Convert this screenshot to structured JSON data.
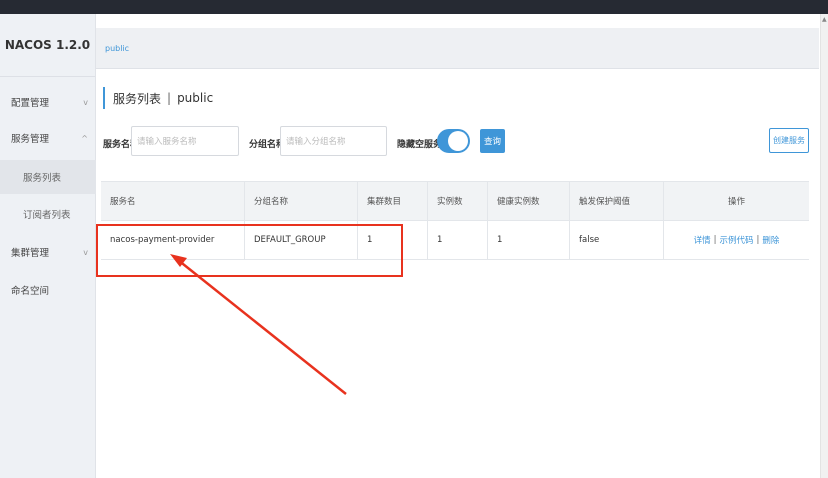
{
  "app": {
    "title": "NACOS 1.2.0"
  },
  "sidebar": {
    "items": [
      {
        "label": "配置管理",
        "chevron": "v"
      },
      {
        "label": "服务管理",
        "chevron": "^"
      },
      {
        "label": "服务列表"
      },
      {
        "label": "订阅者列表"
      },
      {
        "label": "集群管理",
        "chevron": "v"
      },
      {
        "label": "命名空间"
      }
    ]
  },
  "namespace": {
    "current": "public"
  },
  "page": {
    "title": "服务列表",
    "separator": "|",
    "namespace": "public"
  },
  "filters": {
    "service_name_label": "服务名称",
    "service_name_placeholder": "请输入服务名称",
    "group_name_label": "分组名称",
    "group_name_placeholder": "请输入分组名称",
    "hide_empty_label": "隐藏空服务:",
    "hide_empty_on": true,
    "query_label": "查询",
    "create_label": "创建服务"
  },
  "table": {
    "headers": [
      "服务名",
      "分组名称",
      "集群数目",
      "实例数",
      "健康实例数",
      "触发保护阈值",
      "操作"
    ],
    "rows": [
      {
        "service": "nacos-payment-provider",
        "group": "DEFAULT_GROUP",
        "clusters": "1",
        "instances": "1",
        "healthy": "1",
        "protect": "false",
        "ops": [
          "详情",
          "示例代码",
          "删除"
        ],
        "sep": "|"
      }
    ]
  },
  "colors": {
    "accent": "#3f96d8",
    "annotation": "#e8321e",
    "topbar": "#262a33"
  }
}
